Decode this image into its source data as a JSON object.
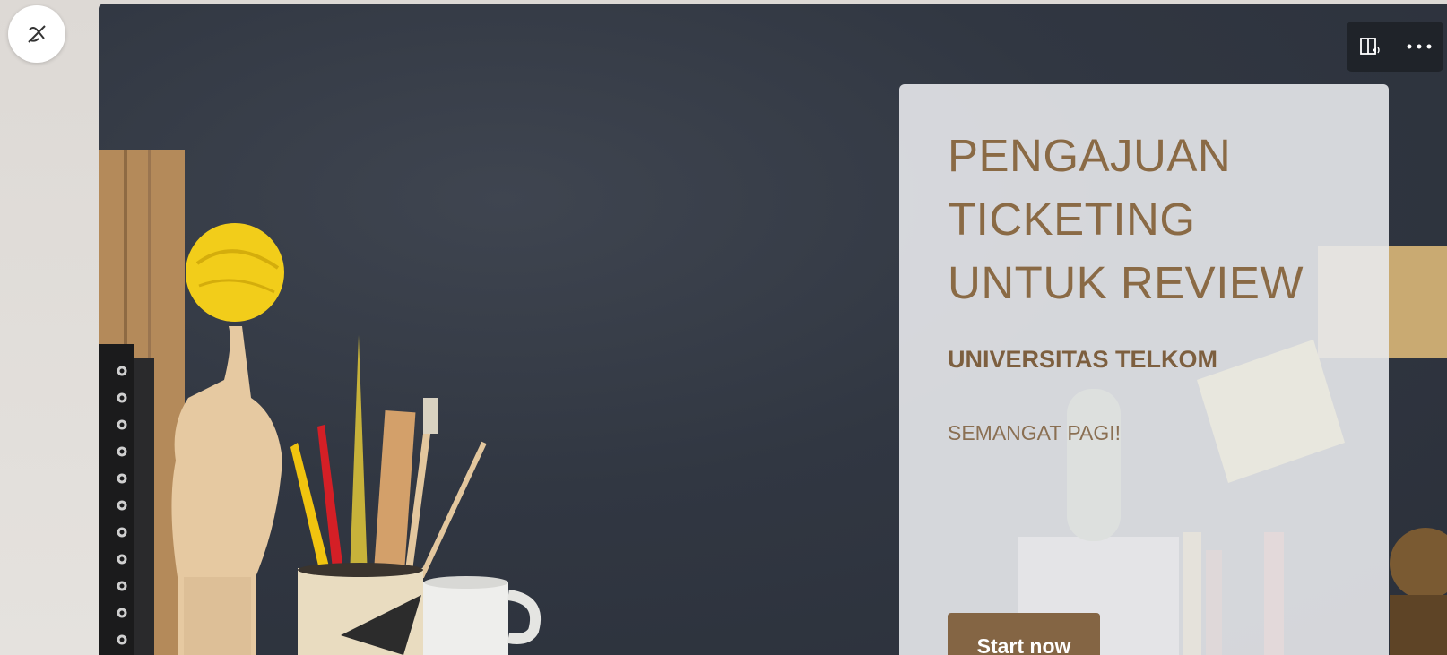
{
  "immersive_toggle": {
    "icon": "immersive-reader-off-icon"
  },
  "toolbar": {
    "read_aloud_icon": "immersive-reader-icon",
    "more_icon": "more-options-icon"
  },
  "form_card": {
    "title_lines": [
      "PENGAJUAN",
      "TICKETING",
      "UNTUK REVIEW"
    ],
    "subtitle": "UNIVERSITAS TELKOM",
    "greeting": "SEMANGAT PAGI!",
    "start_button": "Start now"
  },
  "colors": {
    "accent": "#846544",
    "title_text": "#8a6a45",
    "hero_background": "#313742",
    "toolbar": "#1f2329"
  }
}
